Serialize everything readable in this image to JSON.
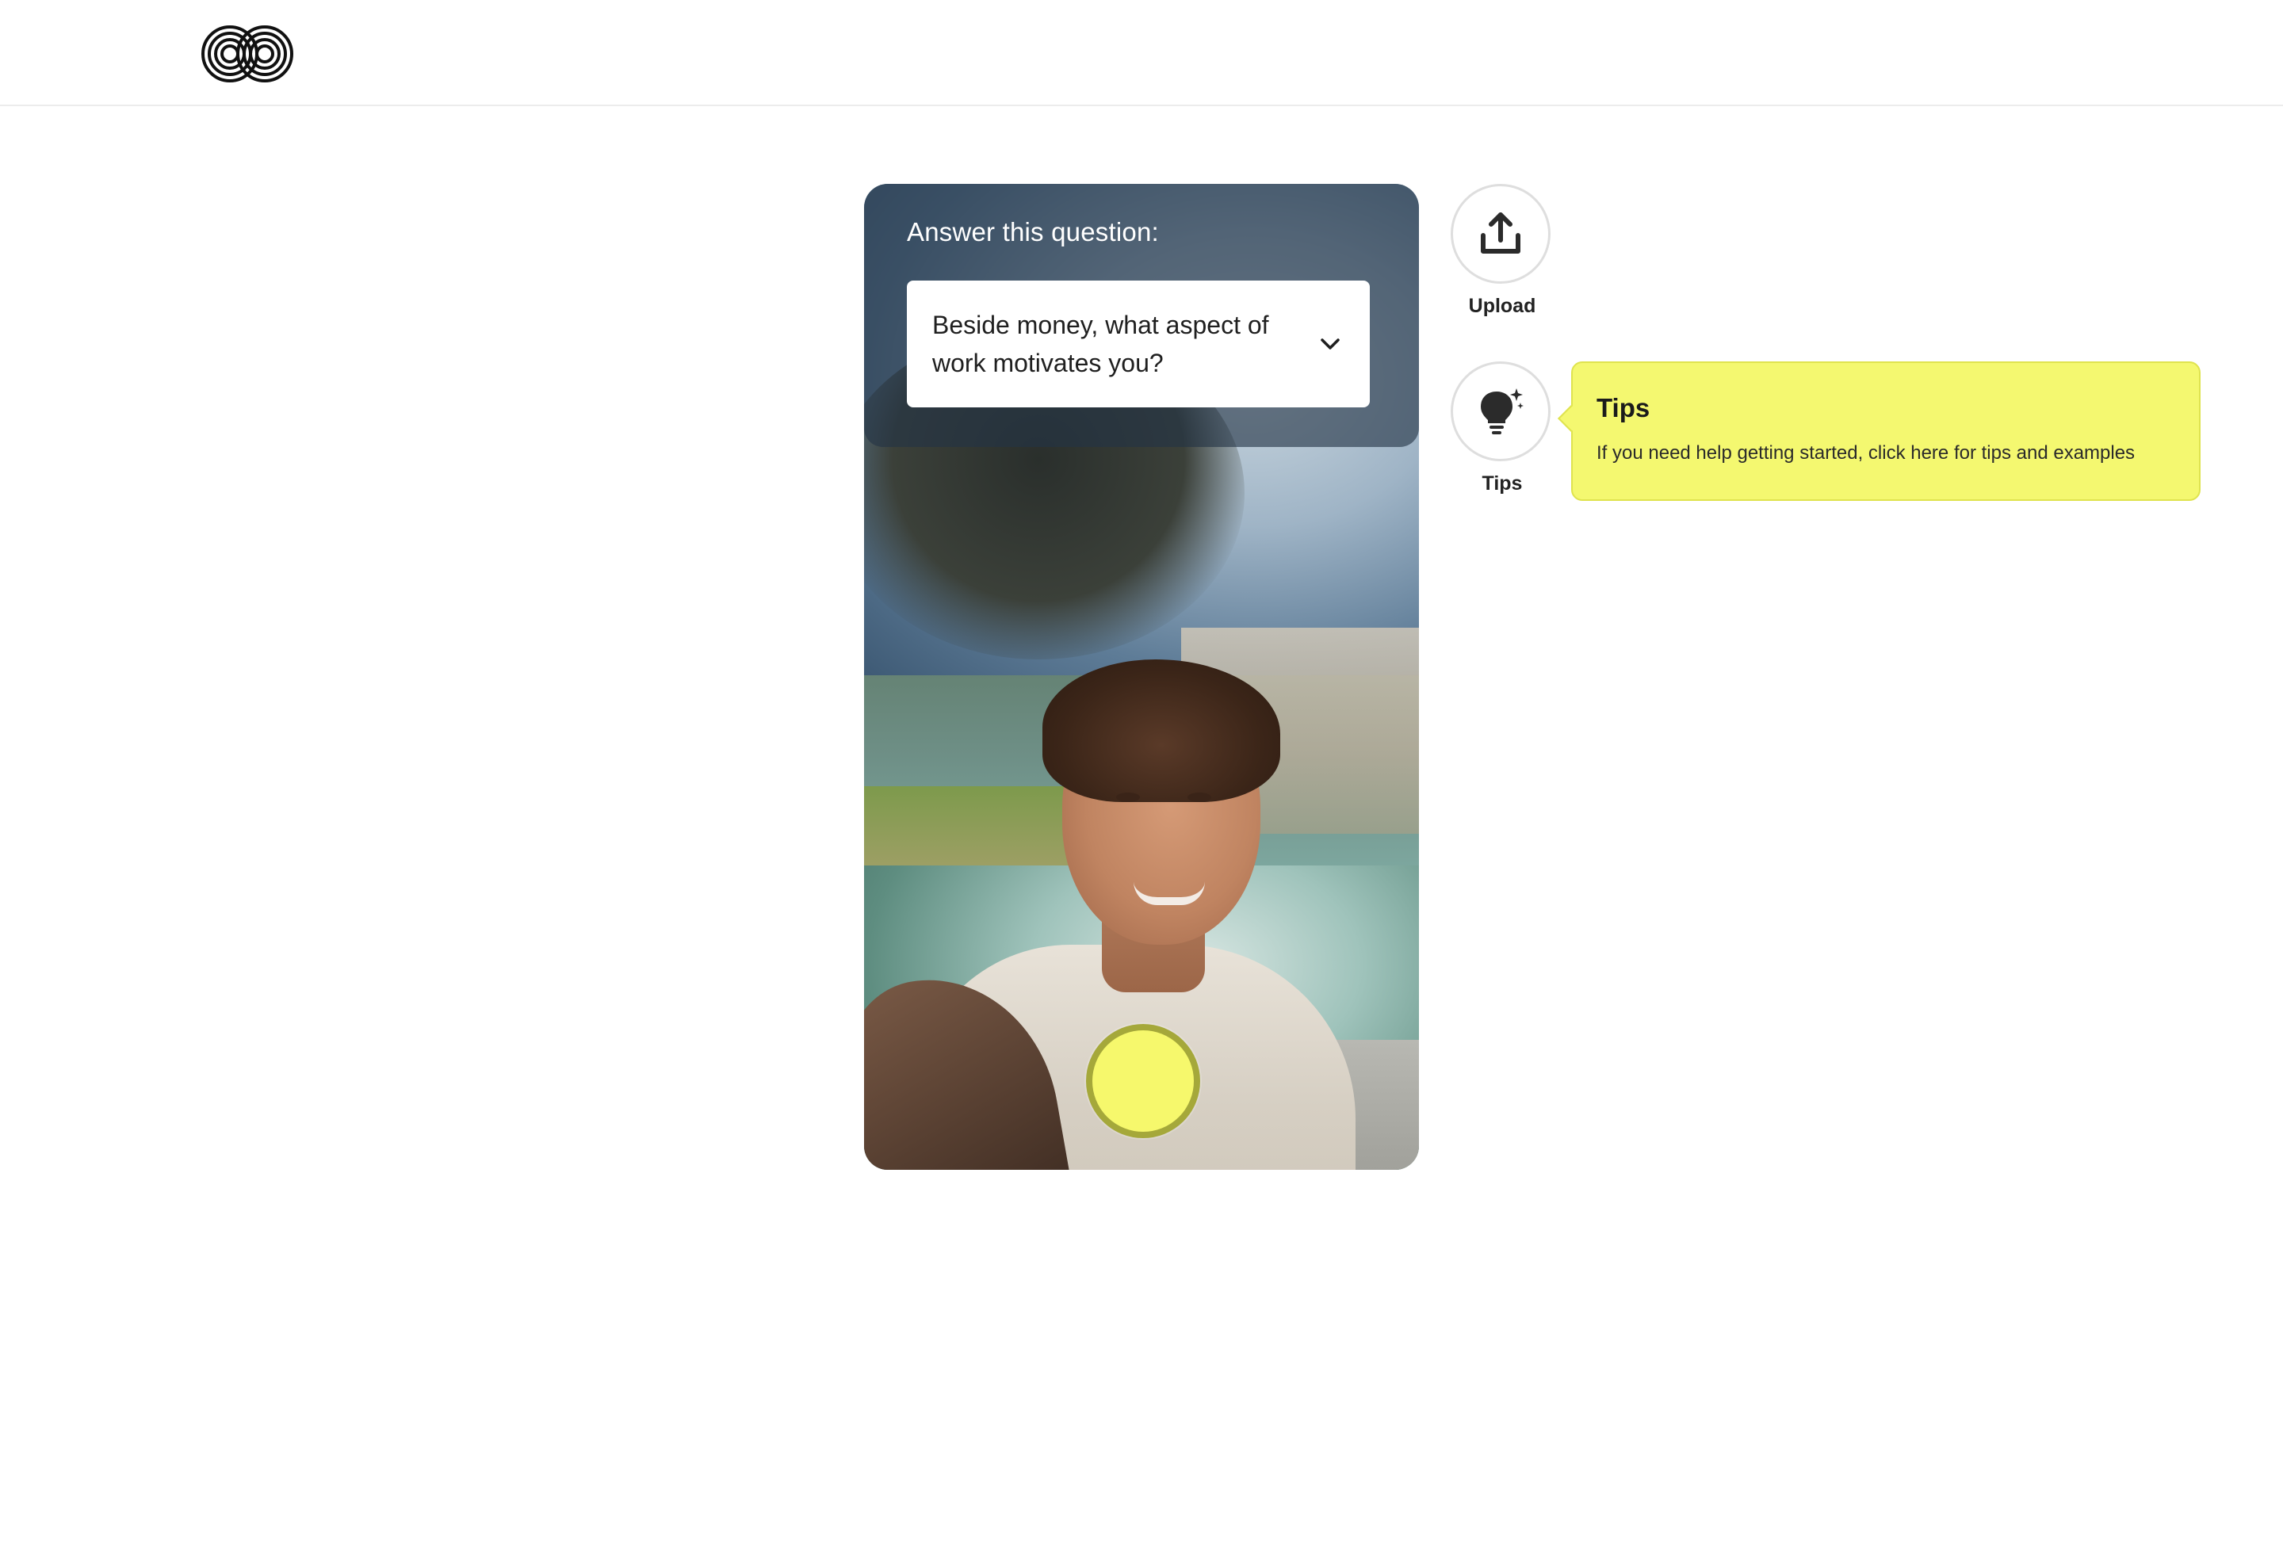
{
  "header": {
    "logo": "pd-logo"
  },
  "recorder": {
    "prompt_label": "Answer this question:",
    "question": "Beside money, what aspect of work motivates you?",
    "record_button": "record-button"
  },
  "actions": {
    "upload_label": "Upload",
    "tips_label": "Tips"
  },
  "tooltip": {
    "title": "Tips",
    "body": "If you need help getting started, click here for tips and examples"
  },
  "colors": {
    "accent_yellow": "#f4f870",
    "record_ring": "#a5a83a",
    "overlay": "#243446"
  },
  "icons": [
    "upload-icon",
    "lightbulb-icon",
    "chevron-down-icon"
  ]
}
